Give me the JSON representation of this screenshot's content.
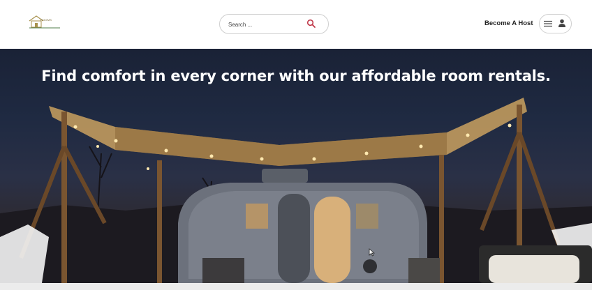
{
  "header": {
    "logo_text": "ROOMS",
    "search": {
      "placeholder": "Search ..."
    },
    "become_host_label": "Become A Host"
  },
  "hero": {
    "title": "Find comfort in every corner with our affordable room rentals."
  },
  "icons": {
    "search": "search-icon",
    "menu": "hamburger-menu-icon",
    "user": "person-icon",
    "cursor": "mouse-cursor-icon"
  },
  "colors": {
    "search_icon": "#c0394a",
    "text_dark": "#222222",
    "border": "#cfcfcf"
  }
}
